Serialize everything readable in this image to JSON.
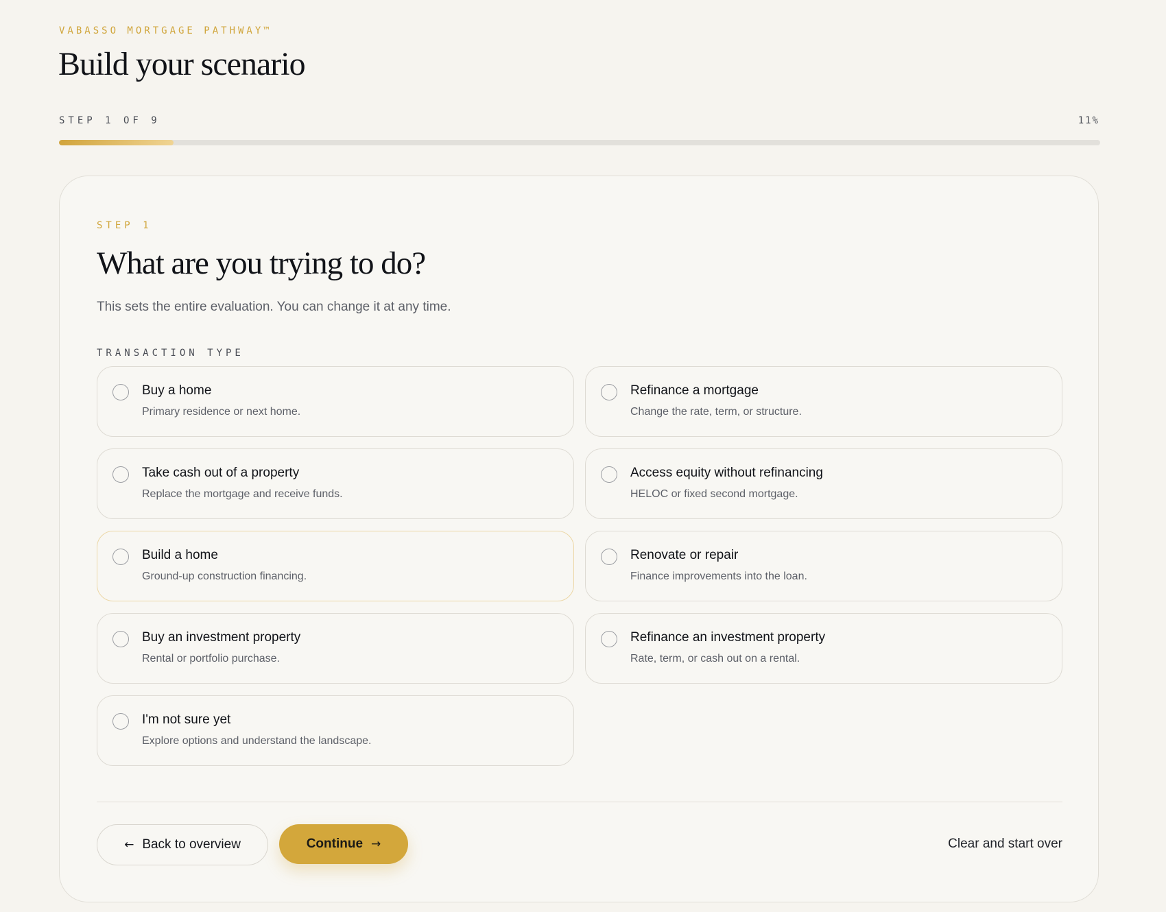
{
  "brand": "VABASSO MORTGAGE PATHWAY™",
  "page_title": "Build your scenario",
  "progress": {
    "label": "STEP 1 OF 9",
    "percent_text": "11%",
    "fraction": 0.11
  },
  "step": {
    "kicker": "STEP 1",
    "question": "What are you trying to do?",
    "subtitle": "This sets the entire evaluation. You can change it at any time.",
    "section_label": "TRANSACTION TYPE",
    "options": [
      {
        "title": "Buy a home",
        "desc": "Primary residence or next home."
      },
      {
        "title": "Refinance a mortgage",
        "desc": "Change the rate, term, or structure."
      },
      {
        "title": "Take cash out of a property",
        "desc": "Replace the mortgage and receive funds."
      },
      {
        "title": "Access equity without refinancing",
        "desc": "HELOC or fixed second mortgage."
      },
      {
        "title": "Build a home",
        "desc": "Ground-up construction financing."
      },
      {
        "title": "Renovate or repair",
        "desc": "Finance improvements into the loan."
      },
      {
        "title": "Buy an investment property",
        "desc": "Rental or portfolio purchase."
      },
      {
        "title": "Refinance an investment property",
        "desc": "Rate, term, or cash out on a rental."
      },
      {
        "title": "I'm not sure yet",
        "desc": "Explore options and understand the landscape."
      }
    ]
  },
  "footer": {
    "back_label": "Back to overview",
    "back_icon": "←",
    "continue_label": "Continue",
    "continue_icon": "→",
    "clear_label": "Clear and start over"
  },
  "colors": {
    "accent": "#d3a73b",
    "background": "#f6f4ef",
    "card": "#f8f7f3"
  }
}
